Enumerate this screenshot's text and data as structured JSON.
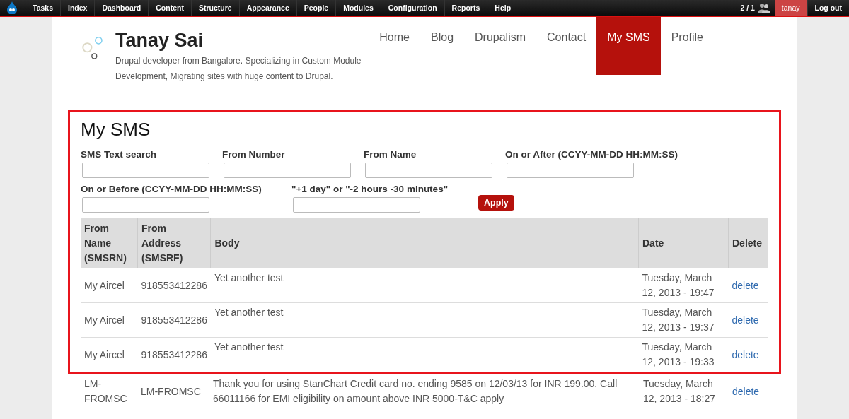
{
  "toolbar": {
    "items": [
      "Tasks",
      "Index",
      "Dashboard",
      "Content",
      "Structure",
      "Appearance",
      "People",
      "Modules",
      "Configuration",
      "Reports",
      "Help"
    ],
    "users_count": "2 / 1",
    "user": "tanay",
    "logout": "Log out"
  },
  "site": {
    "name": "Tanay Sai",
    "slogan": "Drupal developer from Bangalore. Specializing in Custom Module Development, Migrating sites with huge content to Drupal."
  },
  "menu": [
    {
      "label": "Home",
      "selected": false
    },
    {
      "label": "Blog",
      "selected": false
    },
    {
      "label": "Drupalism",
      "selected": false
    },
    {
      "label": "Contact",
      "selected": false
    },
    {
      "label": "My SMS",
      "selected": true
    },
    {
      "label": "Profile",
      "selected": false
    }
  ],
  "page_title": "My SMS",
  "filters": [
    {
      "label": "SMS Text search"
    },
    {
      "label": "From Number"
    },
    {
      "label": "From Name"
    },
    {
      "label": "On or After (CCYY-MM-DD HH:MM:SS)"
    },
    {
      "label": "On or Before (CCYY-MM-DD HH:MM:SS)"
    },
    {
      "label": "\"+1 day\" or \"-2 hours -30 minutes\""
    }
  ],
  "apply_button": "Apply",
  "table": {
    "columns": [
      "From Name (SMSRN)",
      "From Address (SMSRF)",
      "Body",
      "Date",
      "Delete"
    ],
    "rows": [
      {
        "from_name": "My Aircel",
        "from_address": "918553412286",
        "body": "Yet another test",
        "date": "Tuesday, March 12, 2013 - 19:47",
        "delete": "delete",
        "highlighted": true
      },
      {
        "from_name": "My Aircel",
        "from_address": "918553412286",
        "body": "Yet another test",
        "date": "Tuesday, March 12, 2013 - 19:37",
        "delete": "delete",
        "highlighted": true
      },
      {
        "from_name": "My Aircel",
        "from_address": "918553412286",
        "body": "Yet another test",
        "date": "Tuesday, March 12, 2013 - 19:33",
        "delete": "delete",
        "highlighted": true
      },
      {
        "from_name": "LM-FROMSC",
        "from_address": "LM-FROMSC",
        "body": "Thank you for using StanChart Credit card no. ending 9585 on 12/03/13 for INR 199.00. Call 66011166 for EMI eligibility on amount above INR 5000-T&C apply",
        "date": "Tuesday, March 12, 2013 - 18:27",
        "delete": "delete",
        "highlighted": false
      }
    ]
  }
}
